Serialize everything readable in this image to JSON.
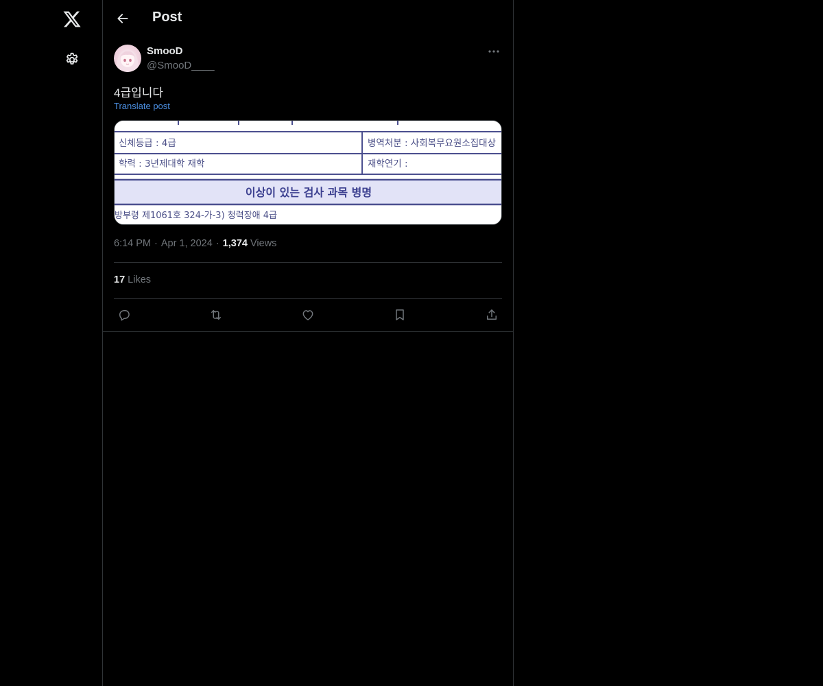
{
  "nav": {
    "logo_icon": "x-logo-icon",
    "settings_icon": "gear-icon"
  },
  "header": {
    "title": "Post",
    "back_icon": "arrow-left-icon"
  },
  "post": {
    "author": {
      "name": "SmooD",
      "handle": "@SmooD____"
    },
    "text": "4급입니다",
    "translate_label": "Translate post",
    "media": {
      "row1_left": "신체등급 : 4급",
      "row1_right": "병역처분 : 사회복무요원소집대상",
      "row2_left": "학력 : 3년제대학 재학",
      "row2_right": "재학연기 :",
      "banner": "이상이 있는 검사 과목 병명",
      "footer": "방부령 제1061호 324-가-3)   청력장애 4급"
    },
    "time": "6:14 PM",
    "date": "Apr 1, 2024",
    "views_count": "1,374",
    "views_label": "Views",
    "likes_count": "17",
    "likes_label": "Likes"
  },
  "colors": {
    "background": "#000000",
    "text_primary": "#e7e9ea",
    "text_secondary": "#71767b",
    "link": "#4b8ee0",
    "border": "#2f3336"
  }
}
